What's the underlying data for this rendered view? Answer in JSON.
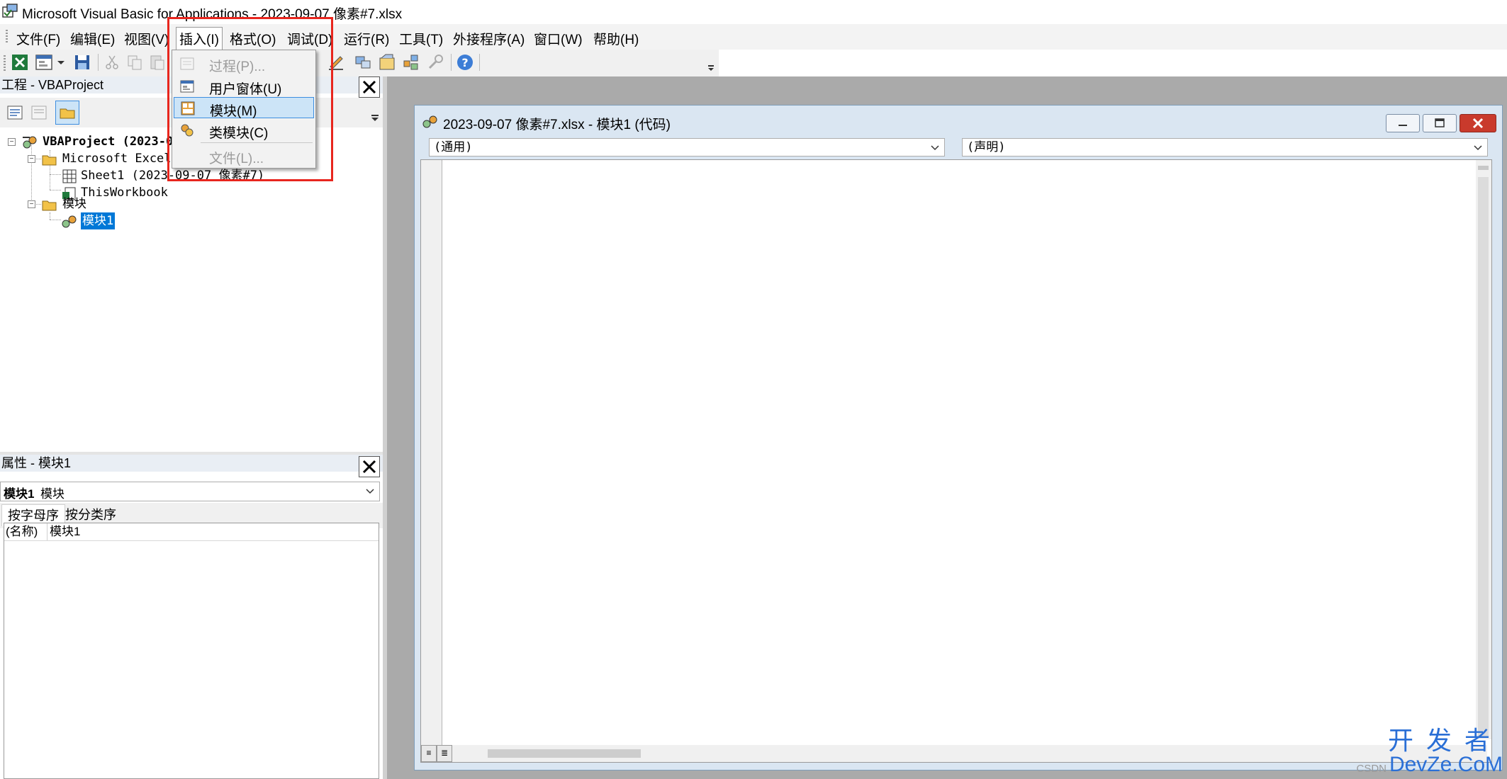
{
  "window": {
    "title": "Microsoft Visual Basic for Applications - 2023-09-07 像素#7.xlsx"
  },
  "menubar": {
    "items": [
      {
        "label": "文件(F)"
      },
      {
        "label": "编辑(E)"
      },
      {
        "label": "视图(V)"
      },
      {
        "label": "插入(I)"
      },
      {
        "label": "格式(O)"
      },
      {
        "label": "调试(D)"
      },
      {
        "label": "运行(R)"
      },
      {
        "label": "工具(T)"
      },
      {
        "label": "外接程序(A)"
      },
      {
        "label": "窗口(W)"
      },
      {
        "label": "帮助(H)"
      }
    ]
  },
  "insert_menu": {
    "items": [
      {
        "label": "过程(P)...",
        "enabled": false,
        "icon": "procedure-icon"
      },
      {
        "label": "用户窗体(U)",
        "enabled": true,
        "icon": "userform-icon"
      },
      {
        "label": "模块(M)",
        "enabled": true,
        "highlighted": true,
        "icon": "module-icon"
      },
      {
        "label": "类模块(C)",
        "enabled": true,
        "icon": "class-module-icon"
      },
      {
        "label": "文件(L)...",
        "enabled": false,
        "icon": ""
      }
    ]
  },
  "project": {
    "title": "工程 - VBAProject",
    "tree": {
      "root": "VBAProject (2023-09",
      "excel_objects_folder": "Microsoft Excel 对",
      "sheet1": "Sheet1 (2023-09-07 像素#7)",
      "thisworkbook": "ThisWorkbook",
      "modules_folder": "模块",
      "module1": "模块1"
    }
  },
  "properties": {
    "title": "属性 - 模块1",
    "object_name": "模块1",
    "object_type": "模块",
    "tabs": [
      "按字母序",
      "按分类序"
    ],
    "rows": [
      {
        "name": "(名称)",
        "value": "模块1"
      }
    ]
  },
  "code_window": {
    "title": "2023-09-07 像素#7.xlsx - 模块1 (代码)",
    "object_combo": "(通用)",
    "procedure_combo": "(声明)"
  },
  "watermark": {
    "line1": "开发者",
    "line2": "DevZe.CoM",
    "small": "CSDN"
  },
  "colors": {
    "highlight_box": "#e8261e",
    "menu_highlight": "#cce4f7",
    "tree_selection": "#0078d7"
  }
}
